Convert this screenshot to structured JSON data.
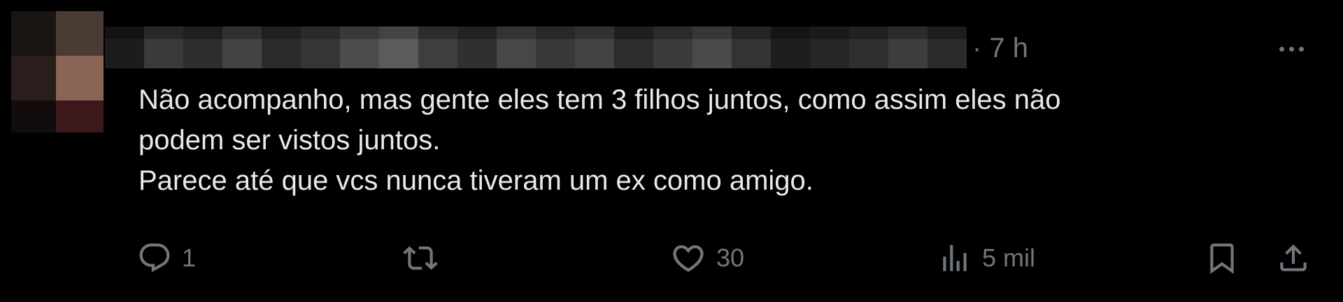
{
  "tweet": {
    "time": "· 7 h",
    "text_lines": [
      "Não acompanho, mas gente eles tem 3 filhos juntos, como assim eles não",
      "podem ser vistos juntos.",
      "Parece até que vcs nunca tiveram um ex como amigo."
    ]
  },
  "actions": {
    "reply_count": "1",
    "retweet_count": "",
    "like_count": "30",
    "views_count": "5 mil"
  },
  "icons": {
    "more": "more-dots-icon",
    "reply": "reply-bubble-icon",
    "retweet": "retweet-arrows-icon",
    "like": "heart-icon",
    "views": "views-bar-chart-icon",
    "bookmark": "bookmark-icon",
    "share": "share-upload-icon"
  },
  "colors": {
    "background": "#000000",
    "text": "#e7e9ea",
    "secondary": "#71767b"
  }
}
